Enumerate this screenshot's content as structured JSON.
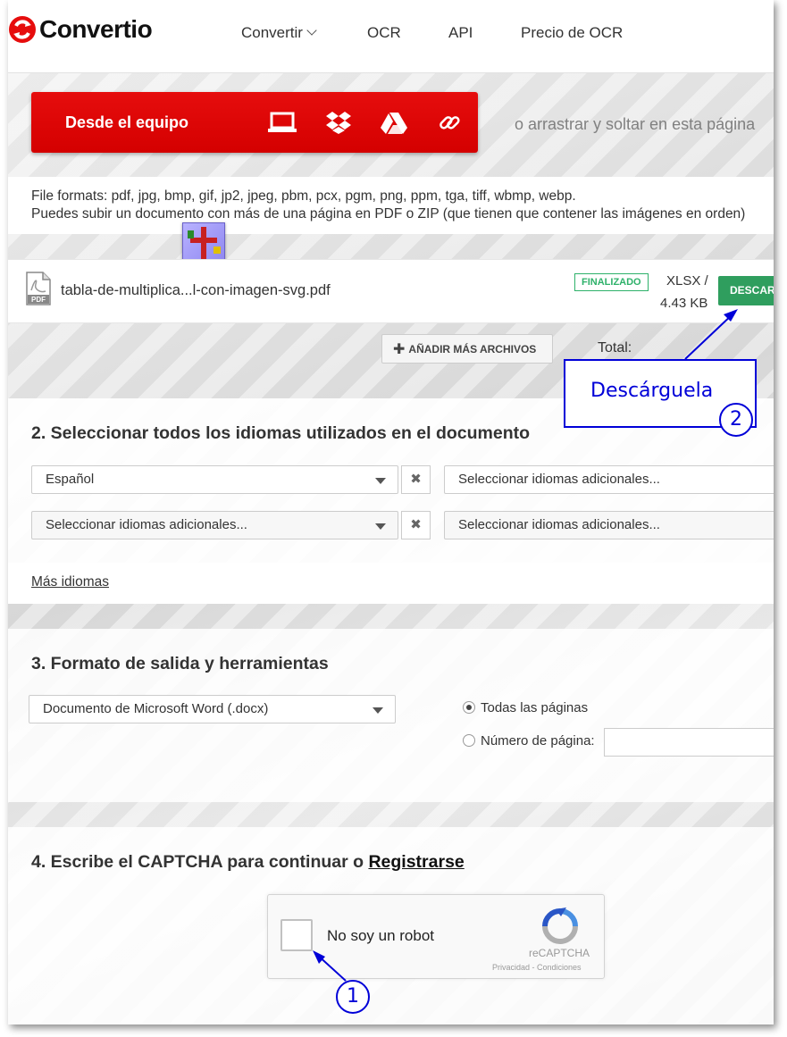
{
  "header": {
    "logo_text": "Convertio",
    "nav": {
      "convertir": "Convertir",
      "ocr": "OCR",
      "api": "API",
      "precio": "Precio de OCR"
    }
  },
  "upload": {
    "button_label": "Desde el equipo",
    "icons": [
      "computer-icon",
      "dropbox-icon",
      "google-drive-icon",
      "link-icon"
    ],
    "drop_text": "o arrastrar y soltar en esta página"
  },
  "formats": {
    "line1": "File formats: pdf, jpg, bmp, gif, jp2, jpeg, pbm, pcx, pgm, png, ppm, tga, tiff, wbmp, webp.",
    "line2": "Puedes subir un documento con más de una página en PDF o ZIP (que tienen que contener las imágenes en orden)"
  },
  "file": {
    "name": "tabla-de-multiplica...l-con-imagen-svg.pdf",
    "status": "FINALIZADO",
    "format": "XLSX /",
    "size": "4.43 KB",
    "download_label": "DESCARGAR",
    "status_color": "#2eb16a",
    "download_color": "#2f9e5e"
  },
  "actions": {
    "add_files": "AÑADIR MÁS ARCHIVOS",
    "total_label": "Total:"
  },
  "languages": {
    "title": "2. Seleccionar todos los idiomas utilizados en el documento",
    "select1": "Español",
    "select2": "Seleccionar idiomas adicionales...",
    "select3": "Seleccionar idiomas adicionales...",
    "select4": "Seleccionar idiomas adicionales...",
    "more": "Más idiomas"
  },
  "output": {
    "title": "3. Formato de salida y herramientas",
    "format_selected": "Documento de Microsoft Word (.docx)",
    "radio_all": "Todas las páginas",
    "radio_page": "Número de página:",
    "page_number_value": ""
  },
  "captcha": {
    "title_prefix": "4. Escribe el CAPTCHA para continuar o ",
    "register_link": "Registrarse",
    "checkbox_label": "No soy un robot",
    "brand": "reCAPTCHA",
    "links": "Privacidad - Condiciones"
  },
  "annotations": {
    "callout": "Descárguela",
    "step1": "1",
    "step2": "2",
    "color": "#0000d8"
  },
  "colors": {
    "brand_red": "#e60d0d"
  }
}
